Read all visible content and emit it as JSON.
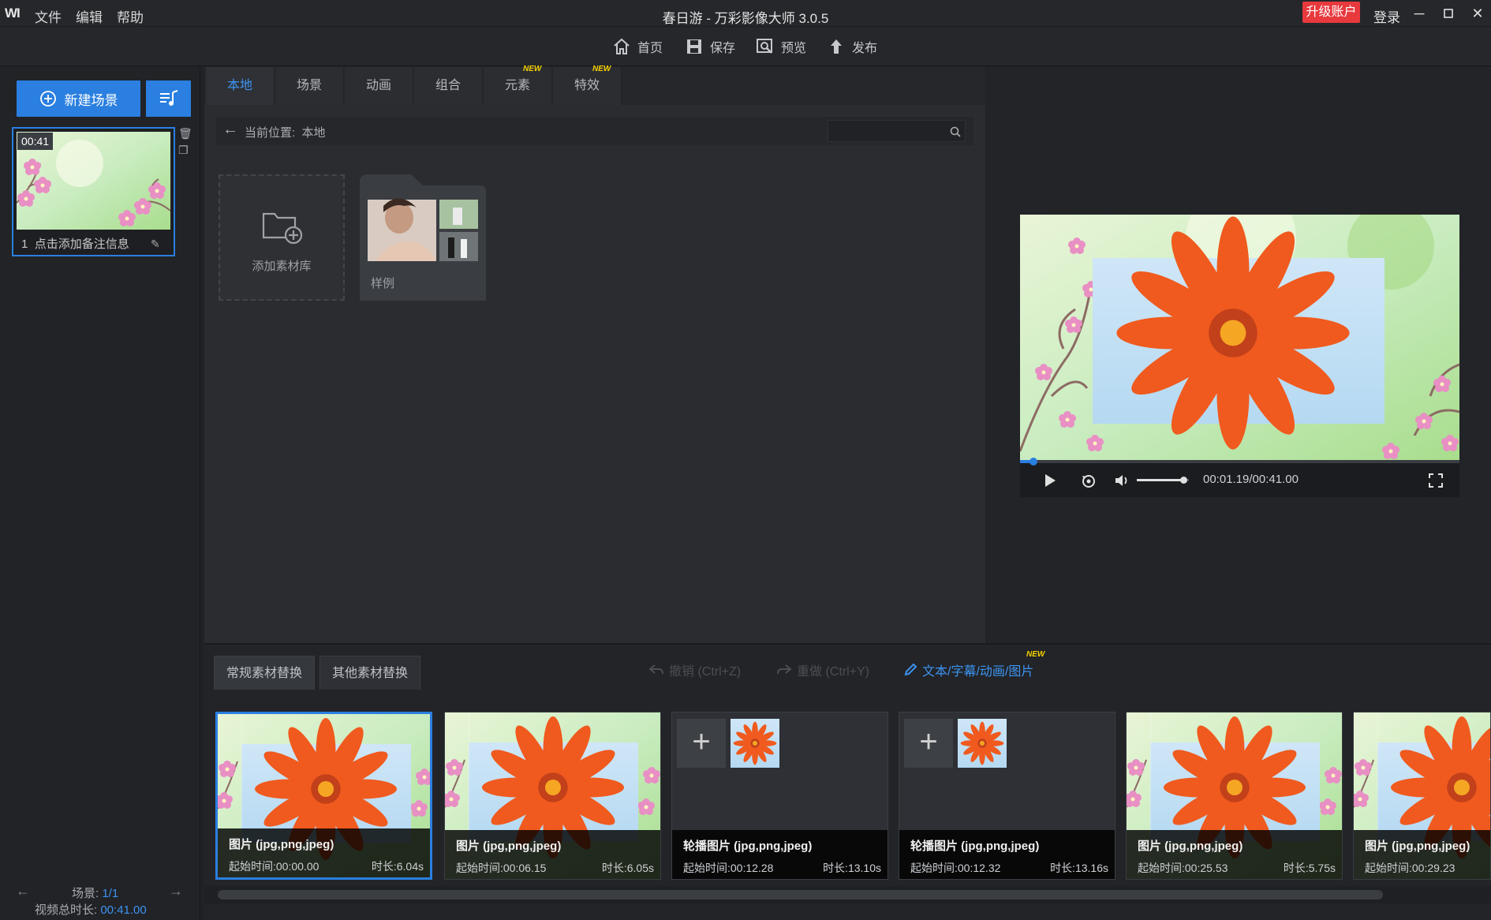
{
  "titlebar": {
    "logo": "WI",
    "menu": [
      "文件",
      "编辑",
      "帮助"
    ],
    "title": "春日游 - 万彩影像大师 3.0.5",
    "upgrade": "升级账户",
    "login": "登录"
  },
  "toolbar": {
    "home": "首页",
    "save": "保存",
    "preview": "预览",
    "publish": "发布"
  },
  "left": {
    "new_scene": "新建场景",
    "scene_duration": "00:41",
    "scene_index": "1",
    "scene_note": "点击添加备注信息",
    "scene_label": "场景:",
    "scene_count": "1/1",
    "total_label": "视频总时长:",
    "total_value": "00:41.00"
  },
  "library": {
    "tabs": [
      "本地",
      "场景",
      "动画",
      "组合",
      "元素",
      "特效"
    ],
    "new_badge": "NEW",
    "crumb_label": "当前位置:",
    "crumb_value": "本地",
    "add_library": "添加素材库",
    "sample": "样例"
  },
  "preview": {
    "time": "00:01.19/00:41.00",
    "progress": 0.03,
    "volume": 0.9
  },
  "bottom": {
    "tab_regular": "常规素材替换",
    "tab_other": "其他素材替换",
    "undo": "撤销 (Ctrl+Z)",
    "redo": "重做 (Ctrl+Y)",
    "text_tool": "文本/字幕/动画/图片",
    "new_badge": "NEW",
    "clips": [
      {
        "type": "图片 (jpg,png,jpeg)",
        "start": "起始时间:00:00.00",
        "duration": "时长:6.04s",
        "kind": "image"
      },
      {
        "type": "图片 (jpg,png,jpeg)",
        "start": "起始时间:00:06.15",
        "duration": "时长:6.05s",
        "kind": "image"
      },
      {
        "type": "轮播图片 (jpg,png,jpeg)",
        "start": "起始时间:00:12.28",
        "duration": "时长:13.10s",
        "kind": "carousel"
      },
      {
        "type": "轮播图片 (jpg,png,jpeg)",
        "start": "起始时间:00:12.32",
        "duration": "时长:13.16s",
        "kind": "carousel"
      },
      {
        "type": "图片 (jpg,png,jpeg)",
        "start": "起始时间:00:25.53",
        "duration": "时长:5.75s",
        "kind": "image"
      },
      {
        "type": "图片 (jpg,png,jpeg)",
        "start": "起始时间:00:29.23",
        "duration": "",
        "kind": "image"
      }
    ]
  },
  "colors": {
    "accent": "#2a7fe0",
    "upgrade": "#e8393d",
    "flower": "#f0521c"
  }
}
